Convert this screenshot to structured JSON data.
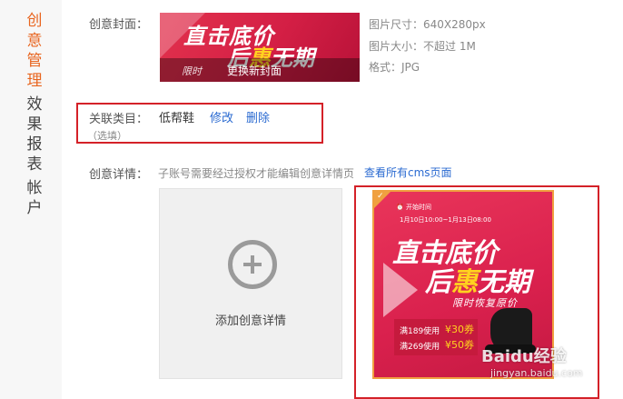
{
  "sidebar": {
    "items": [
      {
        "label": "创意管理",
        "active": true
      },
      {
        "label": "效果报表",
        "active": false
      },
      {
        "label": "帐户",
        "active": false
      }
    ]
  },
  "cover": {
    "label": "创意封面：",
    "banner_line1": "直击底价",
    "banner_line2a": "后",
    "banner_line2b": "惠",
    "banner_line2c": "无期",
    "banner_small": "限时",
    "change_button": "更换新封面",
    "size_info": "图片尺寸：640X280px",
    "weight_info": "图片大小：不超过 1M",
    "format_info": "格式：JPG"
  },
  "category": {
    "label": "关联类目：",
    "value": "低帮鞋",
    "edit": "修改",
    "delete": "删除",
    "optional": "（选填）"
  },
  "detail": {
    "label": "创意详情：",
    "note": "子账号需要经过授权才能编辑创意详情页",
    "view_all": "查看所有cms页面",
    "add_label": "添加创意详情"
  },
  "poster": {
    "tag": "开始时间",
    "date_range": "1月10日10:00~1月13日08:00",
    "line1": "直击底价",
    "line2a": "后",
    "line2b": "惠",
    "line2c": "无期",
    "restore": "限时恢复原价",
    "coupon1_text": "满189使用",
    "coupon1_value": "¥30券",
    "coupon2_text": "满269使用",
    "coupon2_value": "¥50券"
  },
  "watermark": {
    "brand": "Baidu经验",
    "url": "jingyan.baidu.com"
  },
  "colors": {
    "accent": "#e8651f",
    "link": "#2a6ad1",
    "highlight_box": "#d42128",
    "banner": "#d41f45"
  }
}
